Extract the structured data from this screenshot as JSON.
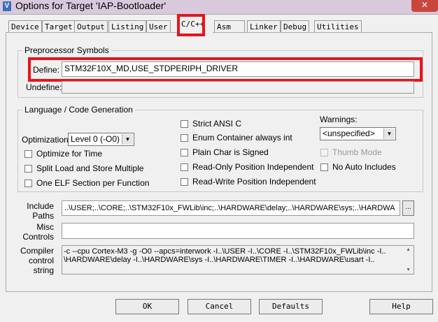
{
  "window": {
    "title": "Options for Target 'IAP-Bootloader'",
    "icon": "keil-uvision-icon",
    "close": "✕"
  },
  "tabs": [
    "Device",
    "Target",
    "Output",
    "Listing",
    "User",
    "C/C++",
    "Asm",
    "Linker",
    "Debug",
    "Utilities"
  ],
  "preprocessor": {
    "group_label": "Preprocessor Symbols",
    "define_label": "Define:",
    "define_value": "STM32F10X_MD,USE_STDPERIPH_DRIVER",
    "undefine_label": "Undefine:",
    "undefine_value": ""
  },
  "language": {
    "group_label": "Language / Code Generation",
    "optimization_label": "Optimization:",
    "optimization_value": "Level 0 (-O0)",
    "checks_left": [
      "Optimize for Time",
      "Split Load and Store Multiple",
      "One ELF Section per Function"
    ],
    "checks_mid": [
      "Strict ANSI C",
      "Enum Container always int",
      "Plain Char is Signed",
      "Read-Only Position Independent",
      "Read-Write Position Independent"
    ],
    "warnings_label": "Warnings:",
    "warnings_value": "<unspecified>",
    "thumb_mode": "Thumb Mode",
    "no_auto_includes": "No Auto Includes"
  },
  "include": {
    "label1": "Include",
    "label2": "Paths",
    "value": "..\\USER;..\\CORE;..\\STM32F10x_FWLib\\inc;..\\HARDWARE\\delay;..\\HARDWARE\\sys;..\\HARDWA",
    "browse": "..."
  },
  "misc": {
    "label1": "Misc",
    "label2": "Controls",
    "value": ""
  },
  "compiler": {
    "label1": "Compiler",
    "label2": "control",
    "label3": "string",
    "line1": "-c --cpu Cortex-M3 -g -O0 --apcs=interwork -I..\\USER -I..\\CORE -I..\\STM32F10x_FWLib\\inc -I..",
    "line2": "\\HARDWARE\\delay -I..\\HARDWARE\\sys -I..\\HARDWARE\\TIMER -I..\\HARDWARE\\usart -I.."
  },
  "buttons": {
    "ok": "OK",
    "cancel": "Cancel",
    "defaults": "Defaults",
    "help": "Help"
  },
  "colors": {
    "highlight": "#e8141c"
  }
}
